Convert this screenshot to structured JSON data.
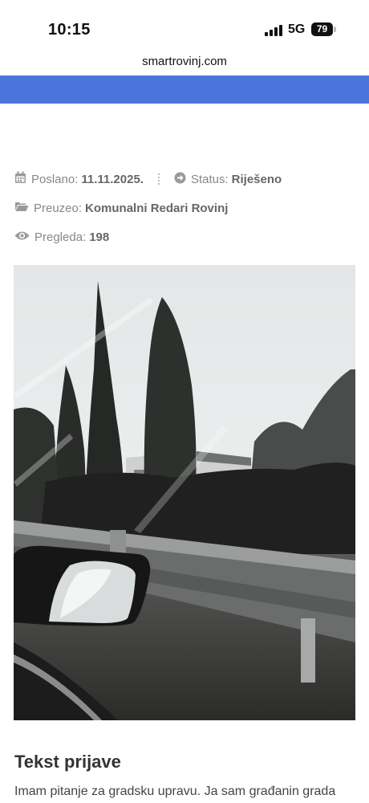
{
  "status_bar": {
    "time": "10:15",
    "network": "5G",
    "battery": "79"
  },
  "browser": {
    "url": "smartrovinj.com"
  },
  "report": {
    "sent_label": "Poslano:",
    "sent_value": "11.11.2025.",
    "status_label": "Status:",
    "status_value": "Riješeno",
    "taken_label": "Preuzeo:",
    "taken_value": "Komunalni Redari Rovinj",
    "views_label": "Pregleda:",
    "views_value": "198"
  },
  "content": {
    "section_title": "Tekst prijave",
    "text": "Imam pitanje za gradsku upravu. Ja sam građanin grada"
  },
  "colors": {
    "accent": "#4a76dc",
    "meta_text": "#888888"
  },
  "icons": [
    "calendar-icon",
    "arrow-circle-icon",
    "folder-open-icon",
    "eye-icon"
  ]
}
